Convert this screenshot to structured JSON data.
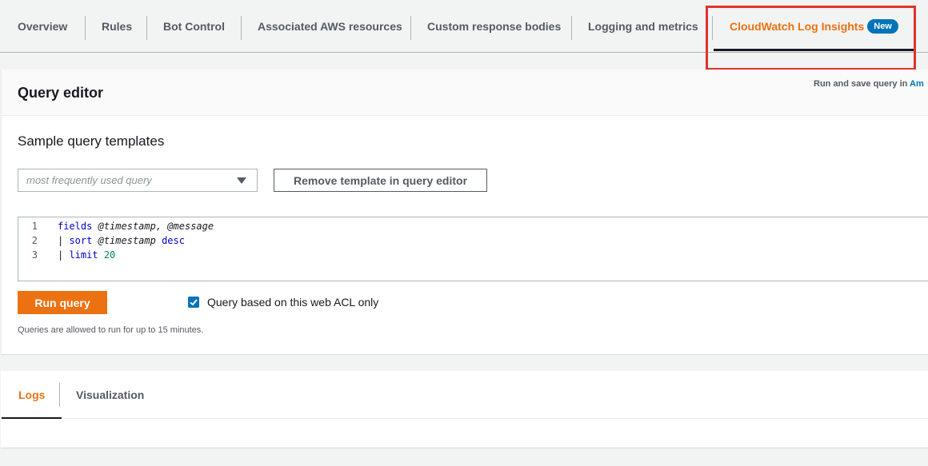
{
  "tabs": [
    {
      "label": "Overview"
    },
    {
      "label": "Rules"
    },
    {
      "label": "Bot Control"
    },
    {
      "label": "Associated AWS resources"
    },
    {
      "label": "Custom response bodies"
    },
    {
      "label": "Logging and metrics"
    },
    {
      "label": "CloudWatch Log Insights",
      "badge": "New",
      "active": true
    }
  ],
  "query_editor": {
    "title": "Query editor",
    "run_save_prefix": "Run and save query in",
    "run_save_link": "Am",
    "section_title": "Sample query templates",
    "template_select_placeholder": "most frequently used query",
    "remove_template_button": "Remove template in query editor",
    "code_lines": [
      {
        "num": "1",
        "text": "fields @timestamp, @message"
      },
      {
        "num": "2",
        "text": "| sort @timestamp desc"
      },
      {
        "num": "3",
        "text": "| limit 20"
      }
    ],
    "run_button": "Run query",
    "checkbox_label": "Query based on this web ACL only",
    "checkbox_checked": true,
    "hint": "Queries are allowed to run for up to 15 minutes."
  },
  "results": {
    "tabs": [
      {
        "label": "Logs",
        "active": true
      },
      {
        "label": "Visualization"
      }
    ]
  },
  "colors": {
    "accent": "#ec7211",
    "link": "#0073bb",
    "highlight": "#e0342b"
  }
}
